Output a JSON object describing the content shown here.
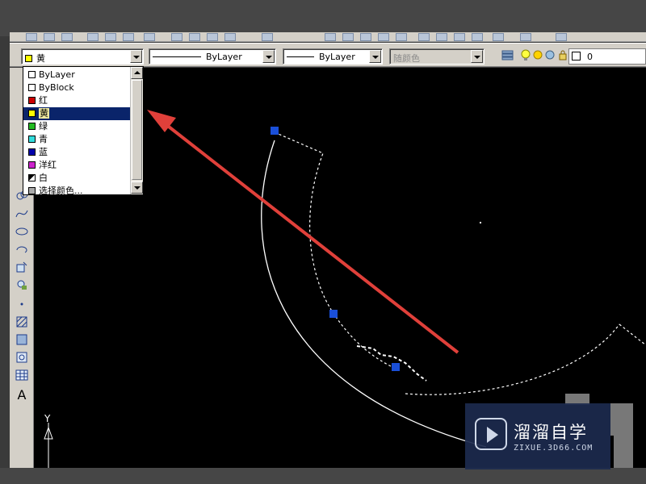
{
  "toolbar": {
    "color_combo": {
      "value": "黄",
      "swatch_color": "#ffff00"
    },
    "linetype_combo": {
      "value": "ByLayer"
    },
    "lineweight_combo": {
      "value": "ByLayer"
    },
    "plotstyle_combo": {
      "value": "随颜色",
      "disabled": true
    },
    "layer_combo": {
      "value": "0"
    }
  },
  "color_dropdown": {
    "items": [
      {
        "label": "ByLayer",
        "swatch_color": "#ffffff"
      },
      {
        "label": "ByBlock",
        "swatch_color": "#ffffff"
      },
      {
        "label": "红",
        "swatch_color": "#cc0000"
      },
      {
        "label": "黄",
        "swatch_color": "#ffff00",
        "selected": true
      },
      {
        "label": "绿",
        "swatch_color": "#22bb22"
      },
      {
        "label": "青",
        "swatch_color": "#33dddd"
      },
      {
        "label": "蓝",
        "swatch_color": "#0000aa"
      },
      {
        "label": "洋红",
        "swatch_color": "#cc22cc"
      },
      {
        "label": "白",
        "swatch_color": "#ffffff"
      },
      {
        "label": "选择颜色...",
        "swatch_color": "#aaaaaa"
      }
    ]
  },
  "canvas": {
    "ucs_label": "Y",
    "arrow_color": "#e0403a",
    "grip_color": "#1a4fd8"
  },
  "watermark": {
    "title": "溜溜自学",
    "subtitle": "ZIXUE.3D66.COM"
  }
}
